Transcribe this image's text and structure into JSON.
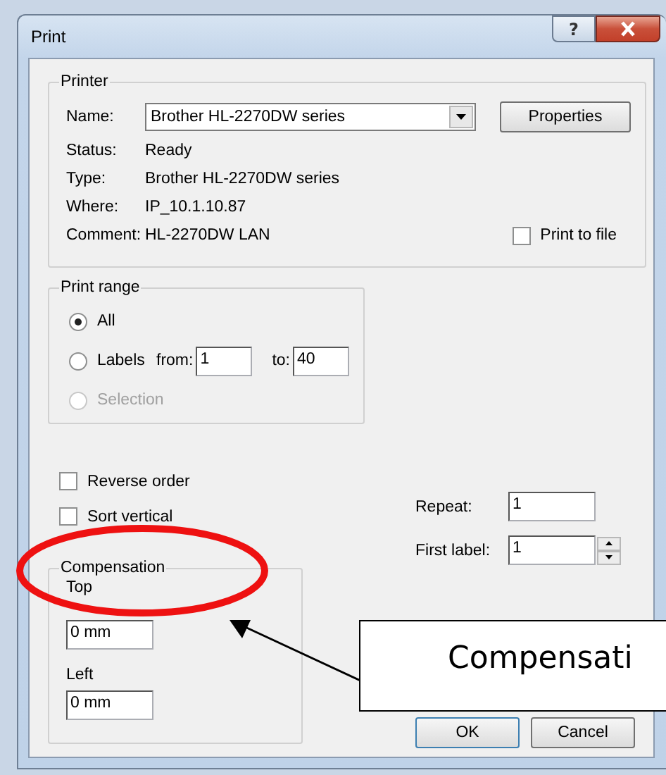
{
  "window": {
    "title": "Print",
    "help_label": "?"
  },
  "printer": {
    "title": "Printer",
    "name_label": "Name:",
    "name_value": "Brother HL-2270DW series",
    "properties_button": "Properties",
    "info": [
      {
        "label": "Status:",
        "value": "Ready"
      },
      {
        "label": "Type:",
        "value": "Brother HL-2270DW series"
      },
      {
        "label": "Where:",
        "value": "IP_10.1.10.87"
      },
      {
        "label": "Comment:",
        "value": "HL-2270DW LAN"
      }
    ],
    "print_to_file": {
      "label": "Print to file",
      "checked": false
    }
  },
  "print_range": {
    "title": "Print range",
    "options": [
      {
        "label": "All",
        "selected": true,
        "disabled": false
      },
      {
        "label": "Labels",
        "selected": false,
        "disabled": false,
        "from_label": "from:",
        "from": "1",
        "to_label": "to:",
        "to": "40"
      },
      {
        "label": "Selection",
        "selected": false,
        "disabled": true
      }
    ]
  },
  "options": [
    {
      "label": "Reverse order",
      "checked": false
    },
    {
      "label": "Sort vertical",
      "checked": false
    }
  ],
  "compensation": {
    "title": "Compensation",
    "fields": [
      {
        "label": "Top",
        "value": "0 mm"
      },
      {
        "label": "Left",
        "value": "0 mm"
      }
    ]
  },
  "repeat": {
    "label": "Repeat:",
    "value": "1"
  },
  "first_label": {
    "label": "First label:",
    "value": "1"
  },
  "buttons": [
    "OK",
    "Cancel"
  ],
  "annotation": {
    "callout": "Compensati"
  }
}
